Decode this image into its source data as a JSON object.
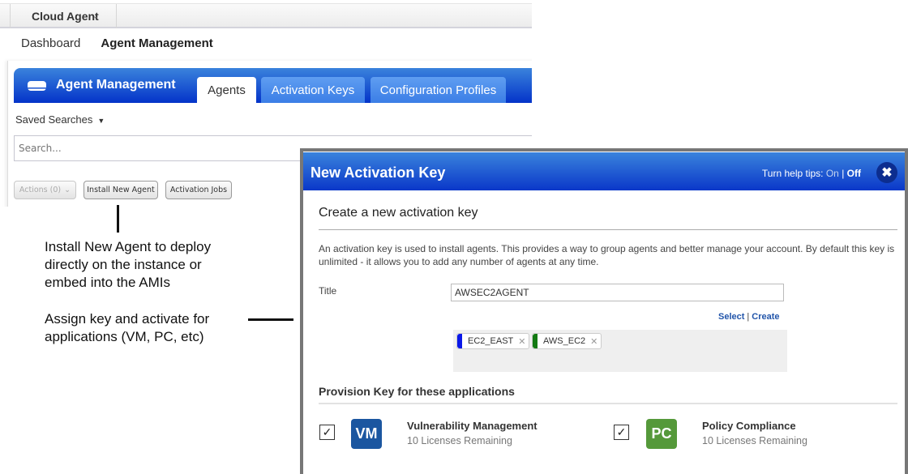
{
  "topbar": {
    "module": "Cloud Agent"
  },
  "nav": {
    "items": [
      "Dashboard",
      "Agent Management"
    ],
    "active_index": 1
  },
  "panel": {
    "title": "Agent Management",
    "tabs": [
      {
        "label": "Agents",
        "active": true
      },
      {
        "label": "Activation Keys",
        "active": false
      },
      {
        "label": "Configuration Profiles",
        "active": false
      }
    ],
    "saved_searches": "Saved Searches",
    "search_placeholder": "Search...",
    "buttons": {
      "actions": "Actions (0)",
      "install": "Install New Agent",
      "jobs": "Activation Jobs"
    }
  },
  "annotations": {
    "install": "Install New Agent to deploy\ndirectly on the instance or\nembed into the AMIs",
    "assign": "Assign key and activate for\napplications (VM, PC, etc)"
  },
  "dialog": {
    "title": "New Activation Key",
    "help_prefix": "Turn help tips:",
    "help_on": "On",
    "help_sep": "|",
    "help_off": "Off",
    "subtitle": "Create a new activation key",
    "description": "An activation key is used to install agents. This provides a way to group agents and better manage your account. By default this key is unlimited - it allows you to add any number of agents at any time.",
    "title_label": "Title",
    "title_value": "AWSEC2AGENT",
    "select_link": "Select",
    "link_sep": "|",
    "create_link": "Create",
    "tags": [
      {
        "label": "EC2_EAST",
        "color": "#0a18e8"
      },
      {
        "label": "AWS_EC2",
        "color": "#137a13"
      }
    ],
    "provision_heading": "Provision Key for these applications",
    "apps": [
      {
        "badge": "VM",
        "name": "Vulnerability Management",
        "licenses": "10 Licenses Remaining",
        "checked": true,
        "color": "#1b56a0"
      },
      {
        "badge": "PC",
        "name": "Policy Compliance",
        "licenses": "10 Licenses Remaining",
        "checked": true,
        "color": "#55993a"
      }
    ]
  }
}
